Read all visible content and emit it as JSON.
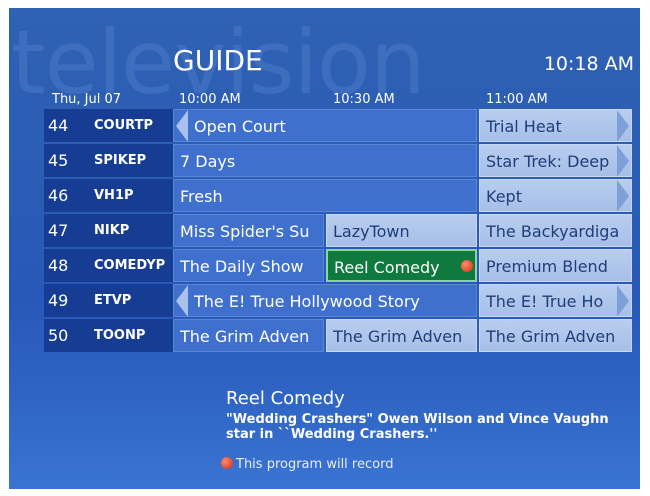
{
  "watermark": "television",
  "header": {
    "title": "GUIDE",
    "clock": "10:18 AM"
  },
  "timebar": {
    "date": "Thu, Jul 07",
    "slots": [
      "10:00 AM",
      "10:30 AM",
      "11:00 AM"
    ]
  },
  "channels": [
    {
      "number": "44",
      "callsign": "COURTP",
      "programs": [
        "Open Court",
        "Trial Heat"
      ]
    },
    {
      "number": "45",
      "callsign": "SPIKEP",
      "programs": [
        "7 Days",
        "Star Trek: Deep"
      ]
    },
    {
      "number": "46",
      "callsign": "VH1P",
      "programs": [
        "Fresh",
        "Kept"
      ]
    },
    {
      "number": "47",
      "callsign": "NIKP",
      "programs": [
        "Miss Spider's Su",
        "LazyTown",
        "The Backyardiga"
      ]
    },
    {
      "number": "48",
      "callsign": "COMEDYP",
      "programs": [
        "The Daily Show",
        "Reel Comedy",
        "Premium Blend"
      ]
    },
    {
      "number": "49",
      "callsign": "ETVP",
      "programs": [
        "The E! True Hollywood Story",
        "The E! True Ho"
      ]
    },
    {
      "number": "50",
      "callsign": "TOONP",
      "programs": [
        "The Grim Adven",
        "The Grim Adven",
        "The Grim Adven"
      ]
    }
  ],
  "details": {
    "title": "Reel Comedy",
    "description": "\"Wedding Crashers\" Owen Wilson and Vince Vaughn star in ``Wedding Crashers.''",
    "record_note": "This program will record"
  },
  "colors": {
    "selected": "#0e7a3d",
    "record": "#d42a10",
    "background": "#2a5db5"
  }
}
